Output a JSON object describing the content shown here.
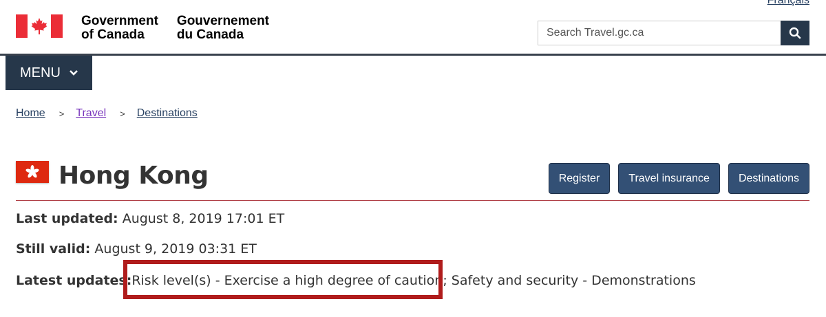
{
  "header": {
    "language_link": "Français",
    "brand": {
      "en_line1": "Government",
      "en_line2": "of Canada",
      "fr_line1": "Gouvernement",
      "fr_line2": "du Canada",
      "flag_colors": {
        "red": "#eb2d37",
        "white": "#ffffff"
      }
    },
    "search": {
      "placeholder": "Search Travel.gc.ca",
      "button_icon": "search-icon"
    },
    "menu_label": "MENU",
    "menu_icon": "chevron-down-icon"
  },
  "breadcrumb": {
    "items": [
      "Home",
      "Travel",
      "Destinations"
    ],
    "separator": ">"
  },
  "page": {
    "title": "Hong Kong",
    "flag_icon": "hong-kong-flag-icon",
    "actions": [
      "Register",
      "Travel insurance",
      "Destinations"
    ]
  },
  "info": {
    "last_updated_label": "Last updated:",
    "last_updated_value": "August 8, 2019 17:01 ET",
    "still_valid_label": "Still valid:",
    "still_valid_value": "August 9, 2019 03:31 ET",
    "latest_updates_label": "Latest updates:",
    "latest_updates_highlighted": "Risk level(s) - Exercise a high degree of caution;",
    "latest_updates_rest": " Safety and security - Demonstrations"
  },
  "colors": {
    "header_navy": "#26374a",
    "button_blue": "#335075",
    "link": "#284162",
    "visited_link": "#7834bc",
    "title_rule": "#af3c43",
    "annotation_box": "#b01c1c"
  }
}
